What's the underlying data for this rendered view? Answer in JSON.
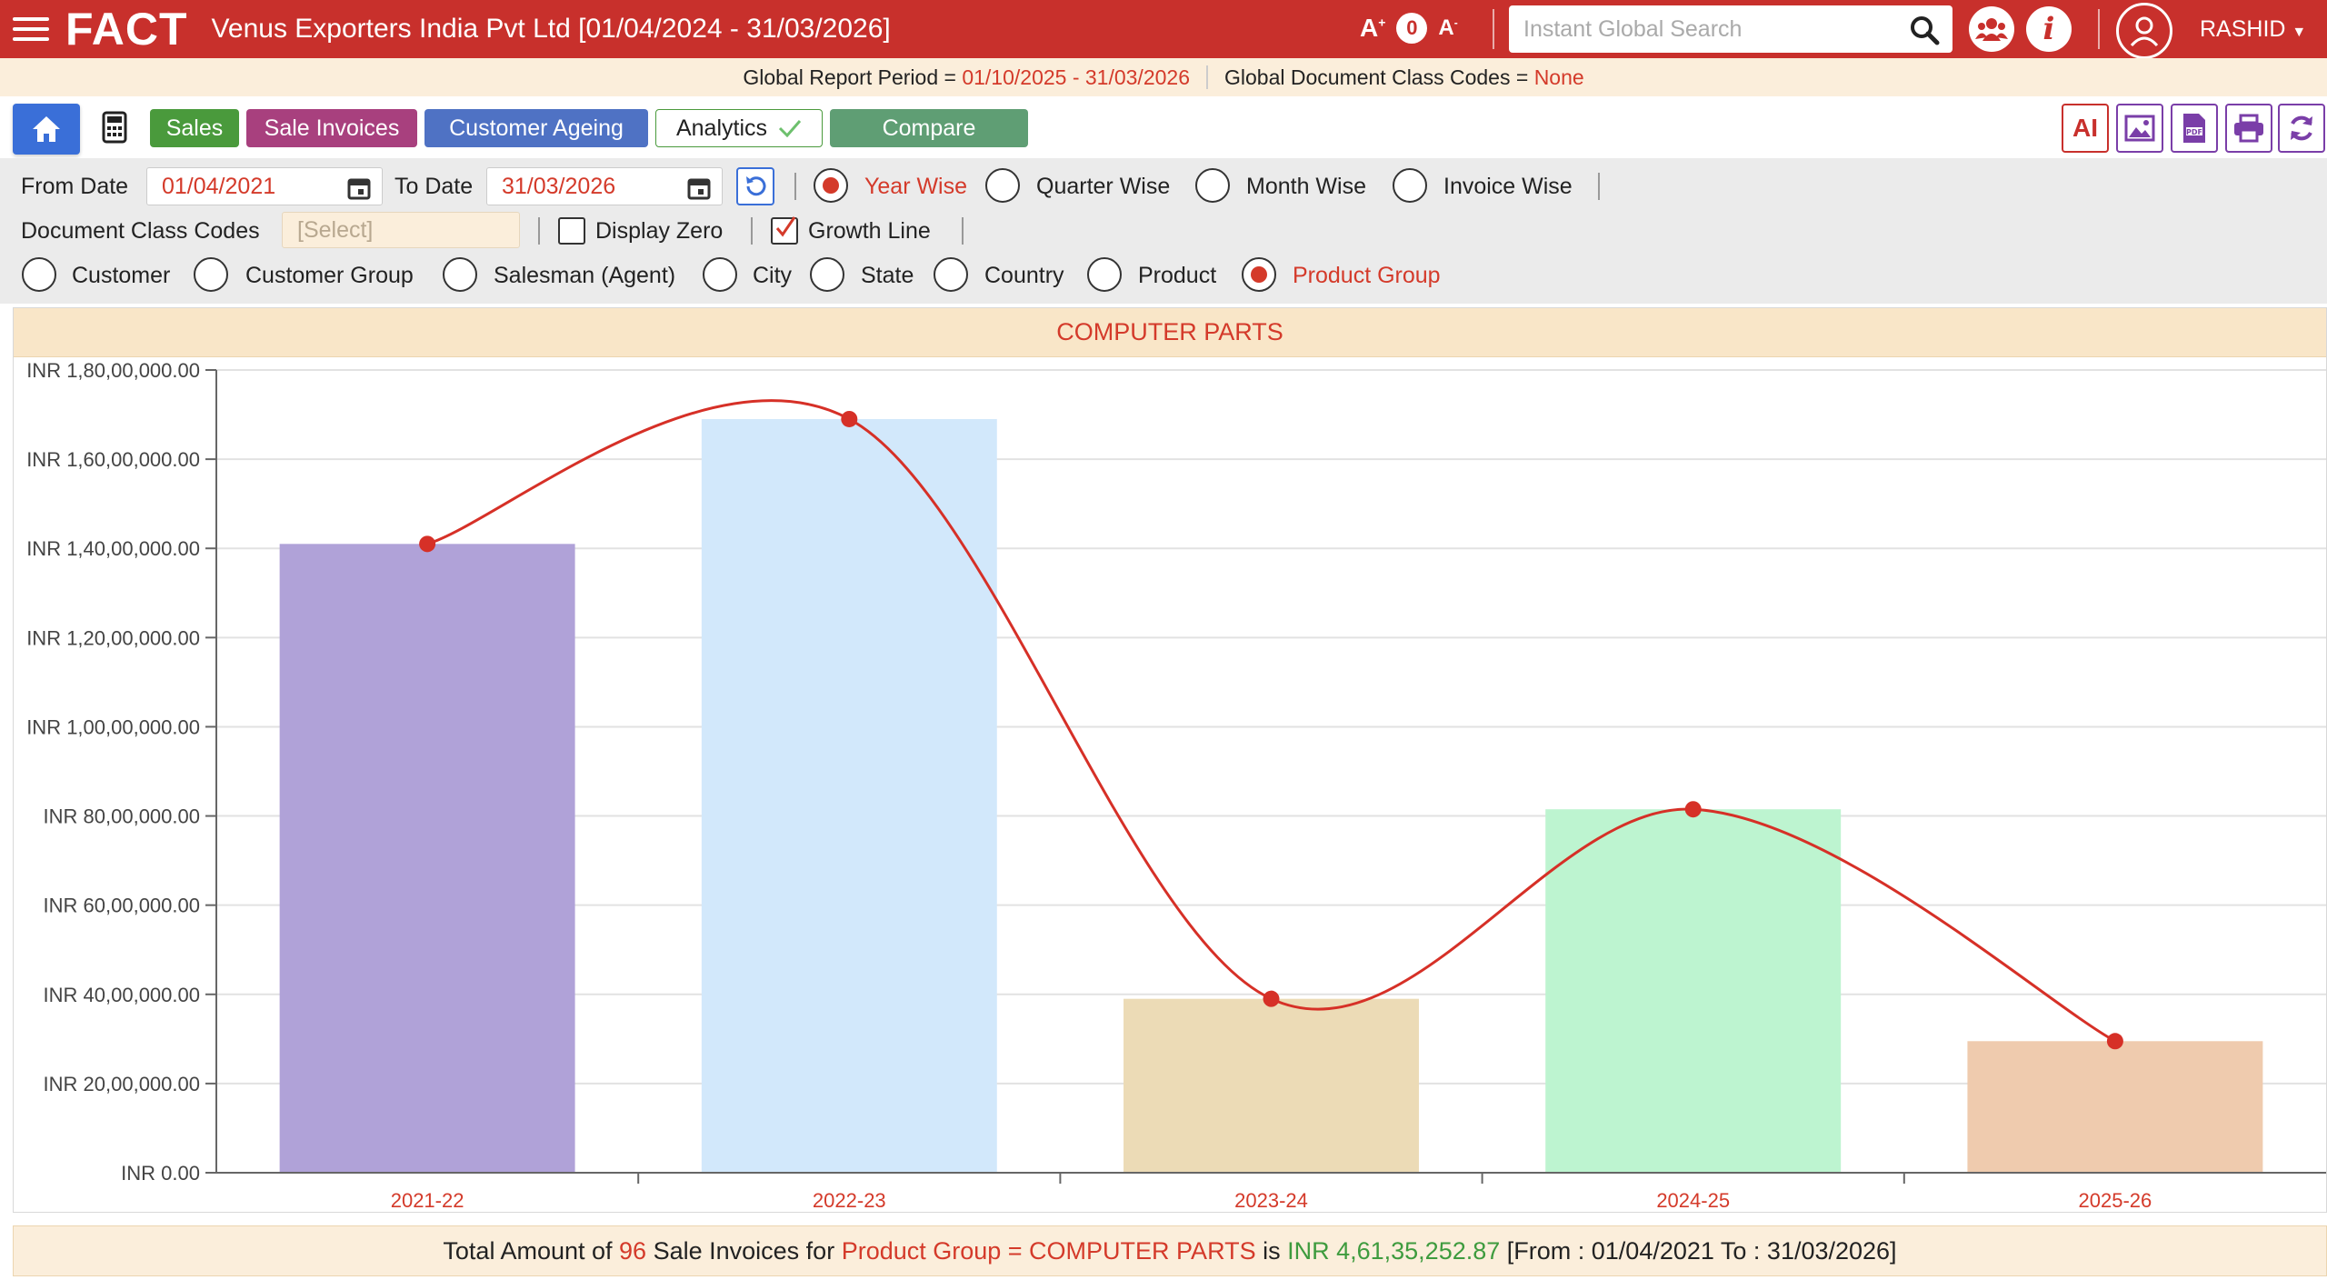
{
  "header": {
    "logo": "FACT",
    "company": "Venus Exporters India Pvt Ltd [01/04/2024 - 31/03/2026]",
    "font_increase": "A",
    "font_counter": "0",
    "font_decrease": "A",
    "search_placeholder": "Instant Global Search",
    "user": "RASHID"
  },
  "period_bar": {
    "report_label": "Global Report Period = ",
    "report_value": "01/10/2025 - 31/03/2026",
    "codes_label": "Global Document Class Codes = ",
    "codes_value": "None"
  },
  "toolbar": {
    "chips": [
      {
        "label": "Sales",
        "color": "#4a9a3c"
      },
      {
        "label": "Sale Invoices",
        "color": "#a8407e"
      },
      {
        "label": "Customer Ageing",
        "color": "#4f72c4"
      },
      {
        "label": "Analytics",
        "color": "#ffffff"
      },
      {
        "label": "Compare",
        "color": "#5f9e74"
      }
    ]
  },
  "filters": {
    "from_date_label": "From Date",
    "from_date": "01/04/2021",
    "to_date_label": "To Date",
    "to_date": "31/03/2026",
    "periods": [
      {
        "label": "Year Wise",
        "selected": true
      },
      {
        "label": "Quarter Wise",
        "selected": false
      },
      {
        "label": "Month Wise",
        "selected": false
      },
      {
        "label": "Invoice Wise",
        "selected": false
      }
    ],
    "doc_class_label": "Document Class Codes",
    "doc_class_placeholder": "[Select]",
    "display_zero_label": "Display Zero",
    "display_zero": false,
    "growth_line_label": "Growth Line",
    "growth_line": true,
    "groupings": [
      {
        "label": "Customer",
        "selected": false
      },
      {
        "label": "Customer Group",
        "selected": false
      },
      {
        "label": "Salesman (Agent)",
        "selected": false
      },
      {
        "label": "City",
        "selected": false
      },
      {
        "label": "State",
        "selected": false
      },
      {
        "label": "Country",
        "selected": false
      },
      {
        "label": "Product",
        "selected": false
      },
      {
        "label": "Product Group",
        "selected": true
      }
    ]
  },
  "chart_data": {
    "type": "bar",
    "title": "COMPUTER PARTS",
    "categories": [
      "2021-22",
      "2022-23",
      "2023-24",
      "2024-25",
      "2025-26"
    ],
    "values": [
      14100000,
      16900000,
      3900000,
      8150000,
      2950000
    ],
    "bar_colors": [
      "#b0a2d8",
      "#d2e8fb",
      "#ecdbb6",
      "#bdf4d0",
      "#efcbae"
    ],
    "growth_line": true,
    "line_color": "#d63027",
    "ylim": [
      0,
      18000000
    ],
    "y_ticks": [
      0,
      2000000,
      4000000,
      6000000,
      8000000,
      10000000,
      12000000,
      14000000,
      16000000,
      18000000
    ],
    "y_tick_labels": [
      "INR 0.00",
      "INR 20,00,000.00",
      "INR 40,00,000.00",
      "INR 60,00,000.00",
      "INR 80,00,000.00",
      "INR 1,00,00,000.00",
      "INR 1,20,00,000.00",
      "INR 1,40,00,000.00",
      "INR 1,60,00,000.00",
      "INR 1,80,00,000.00"
    ],
    "grid": true
  },
  "footer": {
    "p1": "Total Amount of ",
    "count": "96",
    "p2": " Sale Invoices for ",
    "group": "Product Group = COMPUTER PARTS",
    "p3": " is ",
    "amount": "INR 4,61,35,252.87",
    "p4": " [From : 01/04/2021 To : 31/03/2026]"
  }
}
